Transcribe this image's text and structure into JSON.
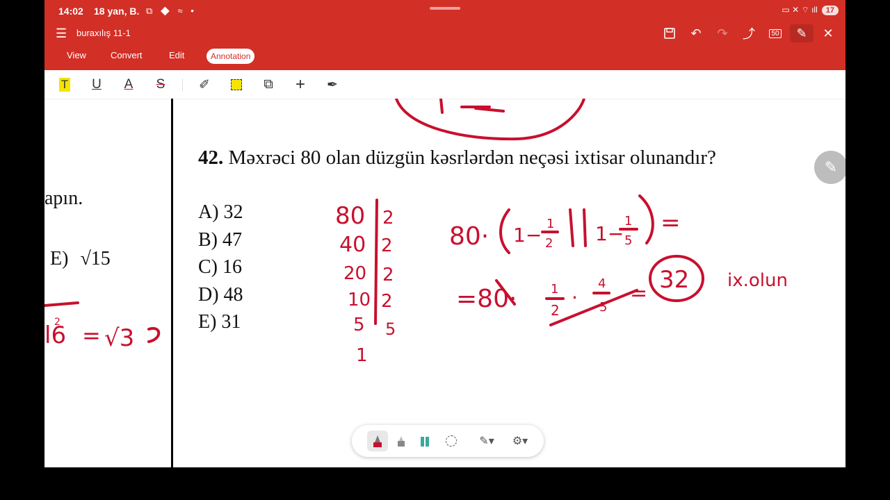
{
  "status_bar": {
    "time": "14:02",
    "date": "18 yan, B.",
    "left_icons": "⧉ ◆ ≈ •",
    "right_icons": "▭ ✕ ⌔ ıll",
    "battery": "17"
  },
  "title_bar": {
    "document_title": "buraxılış 11-1",
    "zoom_label": "50"
  },
  "tabs": [
    {
      "label": "View"
    },
    {
      "label": "Convert"
    },
    {
      "label": "Edit"
    },
    {
      "label": "Annotation"
    }
  ],
  "left_page": {
    "fragment_text": "apın.",
    "option_e_label": "E)",
    "option_e_value": "√15"
  },
  "question": {
    "number": "42.",
    "text": "Məxrəci 80 olan düzgün kəsrlərdən neçəsi ixtisar olunandır?",
    "answers": [
      "A) 32",
      "B) 47",
      "C) 16",
      "D) 48",
      "E) 31"
    ]
  },
  "handwriting": {
    "factor_column": [
      "80",
      "40",
      "20",
      "10",
      "5",
      "1"
    ],
    "divisor_column": [
      "2",
      "2",
      "2",
      "2",
      "5"
    ],
    "result": "32",
    "note": "ix.olun"
  },
  "colors": {
    "brand_red": "#d22f27",
    "ink_red": "#c8102e"
  }
}
